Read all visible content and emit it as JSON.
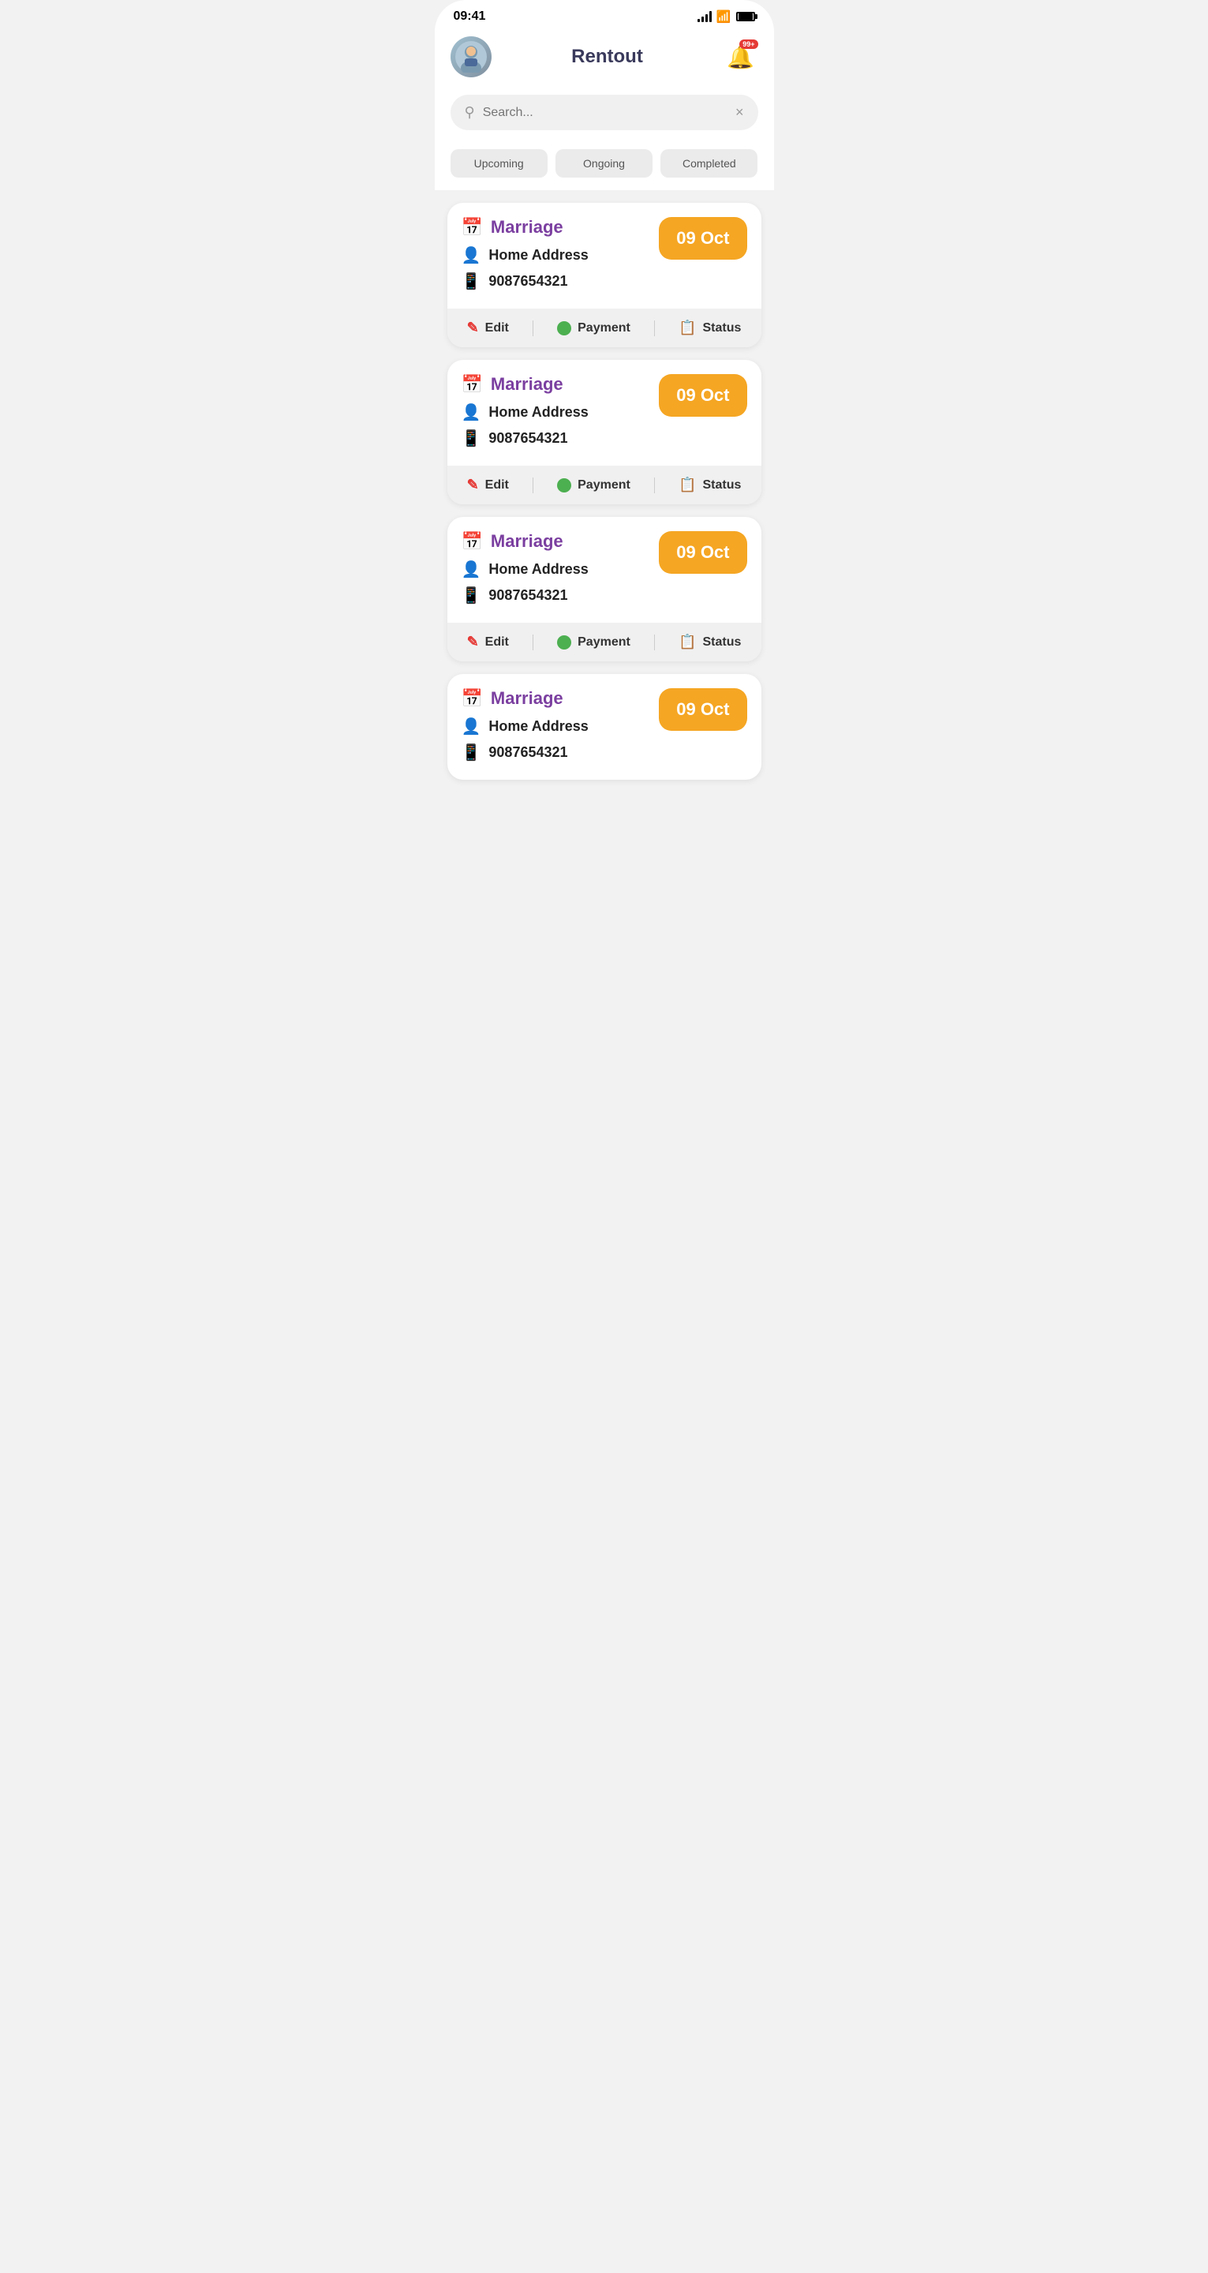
{
  "statusBar": {
    "time": "09:41",
    "batteryLabel": "battery",
    "notificationCount": "99+"
  },
  "header": {
    "title": "Rentout",
    "notificationBadge": "99+"
  },
  "search": {
    "placeholder": "Search...",
    "clearLabel": "×"
  },
  "tabs": [
    {
      "id": "upcoming",
      "label": "Upcoming",
      "active": true
    },
    {
      "id": "ongoing",
      "label": "Ongoing",
      "active": false
    },
    {
      "id": "completed",
      "label": "Completed",
      "active": false
    }
  ],
  "bookings": [
    {
      "id": 1,
      "eventName": "Marriage",
      "address": "Home Address",
      "phone": "9087654321",
      "date": "09 Oct"
    },
    {
      "id": 2,
      "eventName": "Marriage",
      "address": "Home Address",
      "phone": "9087654321",
      "date": "09 Oct"
    },
    {
      "id": 3,
      "eventName": "Marriage",
      "address": "Home Address",
      "phone": "9087654321",
      "date": "09 Oct"
    },
    {
      "id": 4,
      "eventName": "Marriage",
      "address": "Home Address",
      "phone": "9087654321",
      "date": "09 Oct"
    }
  ],
  "actions": {
    "edit": "Edit",
    "payment": "Payment",
    "status": "Status"
  }
}
